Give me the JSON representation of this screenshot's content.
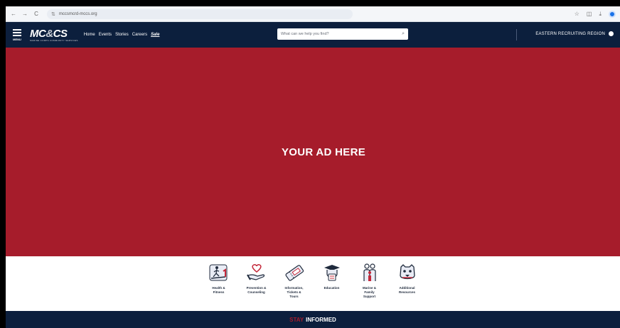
{
  "browser": {
    "back": "←",
    "forward": "→",
    "reload": "C",
    "tune": "⇅",
    "url": "mccsmcrd-mccs.org",
    "icons": [
      "star-icon",
      "sidebar-icon",
      "download-icon",
      "profile-icon"
    ],
    "star": "☆",
    "sidebar": "◫",
    "download": "⤓"
  },
  "header": {
    "menu_label": "MENU",
    "logo_main_1": "MC",
    "logo_amp": "&",
    "logo_main_2": "CS",
    "logo_sub": "MARINE CORPS COMMUNITY SERVICES",
    "nav": [
      "Home",
      "Events",
      "Stories",
      "Careers",
      "Sale"
    ],
    "search_placeholder": "What can we help you find?",
    "search_icon": "⌕",
    "region": "EASTERN RECRUITING REGION"
  },
  "ad": {
    "text": "YOUR AD HERE"
  },
  "categories": [
    {
      "label_1": "Health &",
      "label_2": "Fitness",
      "label_3": ""
    },
    {
      "label_1": "Prevention &",
      "label_2": "Counseling",
      "label_3": ""
    },
    {
      "label_1": "Information,",
      "label_2": "Tickets &",
      "label_3": "Tours"
    },
    {
      "label_1": "Education",
      "label_2": "",
      "label_3": ""
    },
    {
      "label_1": "Marine &",
      "label_2": "Family",
      "label_3": "Support"
    },
    {
      "label_1": "Additional",
      "label_2": "Resources",
      "label_3": ""
    }
  ],
  "stay_informed": {
    "part1": "STAY",
    "part2": "INFORMED"
  },
  "colors": {
    "navy": "#0c1f3d",
    "red": "#a61c2b"
  }
}
